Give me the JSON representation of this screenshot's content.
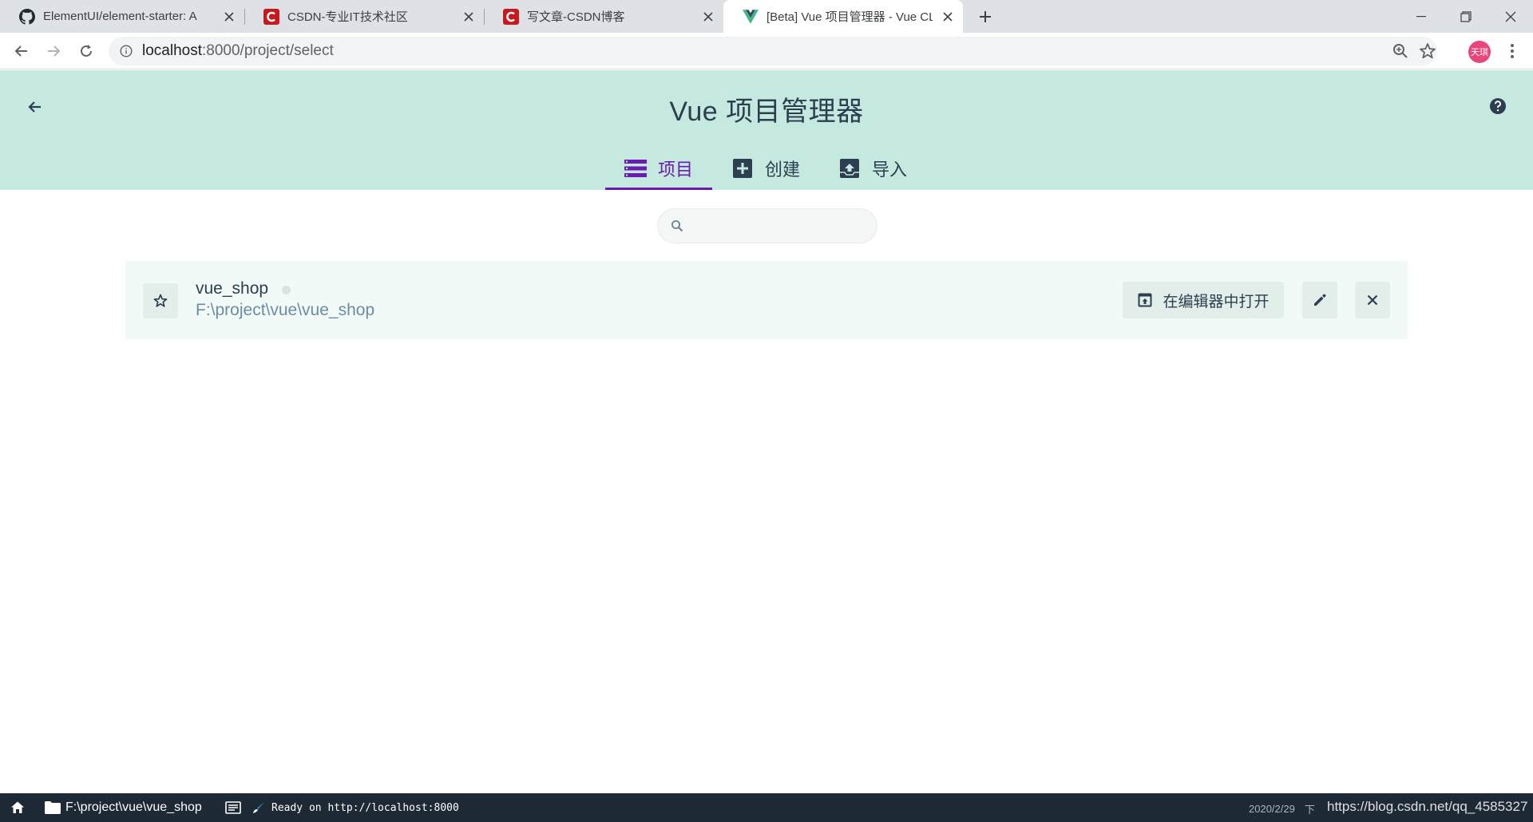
{
  "browser": {
    "tabs": [
      {
        "title": "ElementUI/element-starter: A",
        "favicon": "github-icon"
      },
      {
        "title": "CSDN-专业IT技术社区",
        "favicon": "csdn-icon"
      },
      {
        "title": "写文章-CSDN博客",
        "favicon": "csdn-icon"
      },
      {
        "title": "[Beta] Vue 项目管理器 - Vue CL",
        "favicon": "vue-icon",
        "active": true
      }
    ],
    "url_host": "localhost",
    "url_path": ":8000/project/select",
    "avatar_text": "天琪"
  },
  "header": {
    "title": "Vue 项目管理器",
    "nav": [
      {
        "label": "项目",
        "icon": "list-icon",
        "selected": true
      },
      {
        "label": "创建",
        "icon": "plus-box-icon"
      },
      {
        "label": "导入",
        "icon": "upload-box-icon"
      }
    ]
  },
  "search": {
    "placeholder": "",
    "value": ""
  },
  "projects": [
    {
      "name": "vue_shop",
      "path": "F:\\project\\vue\\vue_shop",
      "open_in_editor_label": "在编辑器中打开"
    }
  ],
  "statusbar": {
    "cwd": "F:\\project\\vue\\vue_shop",
    "log": "Ready on http://localhost:8000",
    "datetime": "2020/2/29",
    "time_suffix": "下",
    "watermark": "https://blog.csdn.net/qq_4585327"
  },
  "colors": {
    "header_bg": "#c5e9df",
    "accent": "#6a1bb1",
    "statusbar_bg": "#1d2935"
  }
}
